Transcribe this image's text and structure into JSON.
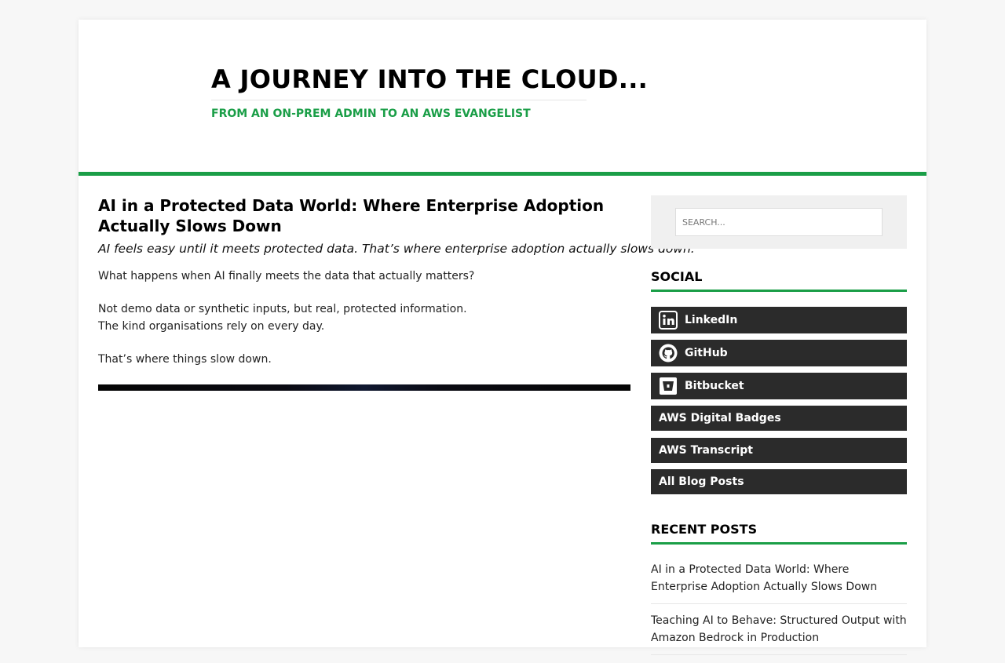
{
  "site": {
    "title": "A JOURNEY INTO THE CLOUD...",
    "tagline": "FROM AN ON-PREM ADMIN TO AN AWS EVANGELIST"
  },
  "post": {
    "title": "AI in a Protected Data World: Where Enterprise Adoption Actually Slows Down",
    "subtitle": "AI feels easy until it meets protected data. That’s where enterprise adoption actually slows down.",
    "paragraphs": [
      "What happens when AI finally meets the data that actually matters?",
      "Not demo data or synthetic inputs, but real, protected information.",
      "The kind organisations rely on every day.",
      "That’s where things slow down."
    ]
  },
  "sidebar": {
    "search": {
      "placeholder": "SEARCH..."
    },
    "social": {
      "title": "SOCIAL",
      "items": [
        {
          "label": "LinkedIn",
          "icon": "linkedin-icon"
        },
        {
          "label": "GitHub",
          "icon": "github-icon"
        },
        {
          "label": "Bitbucket",
          "icon": "bitbucket-icon"
        }
      ],
      "links": [
        {
          "label": "AWS Digital Badges"
        },
        {
          "label": "AWS Transcript"
        },
        {
          "label": "All Blog Posts"
        }
      ]
    },
    "recent": {
      "title": "RECENT POSTS",
      "items": [
        {
          "label": "AI in a Protected Data World: Where Enterprise Adoption Actually Slows Down"
        },
        {
          "label": "Teaching AI to Behave: Structured Output with Amazon Bedrock in Production"
        }
      ]
    }
  },
  "colors": {
    "accent": "#1a9e47",
    "dark_button": "#2b2b2b"
  }
}
